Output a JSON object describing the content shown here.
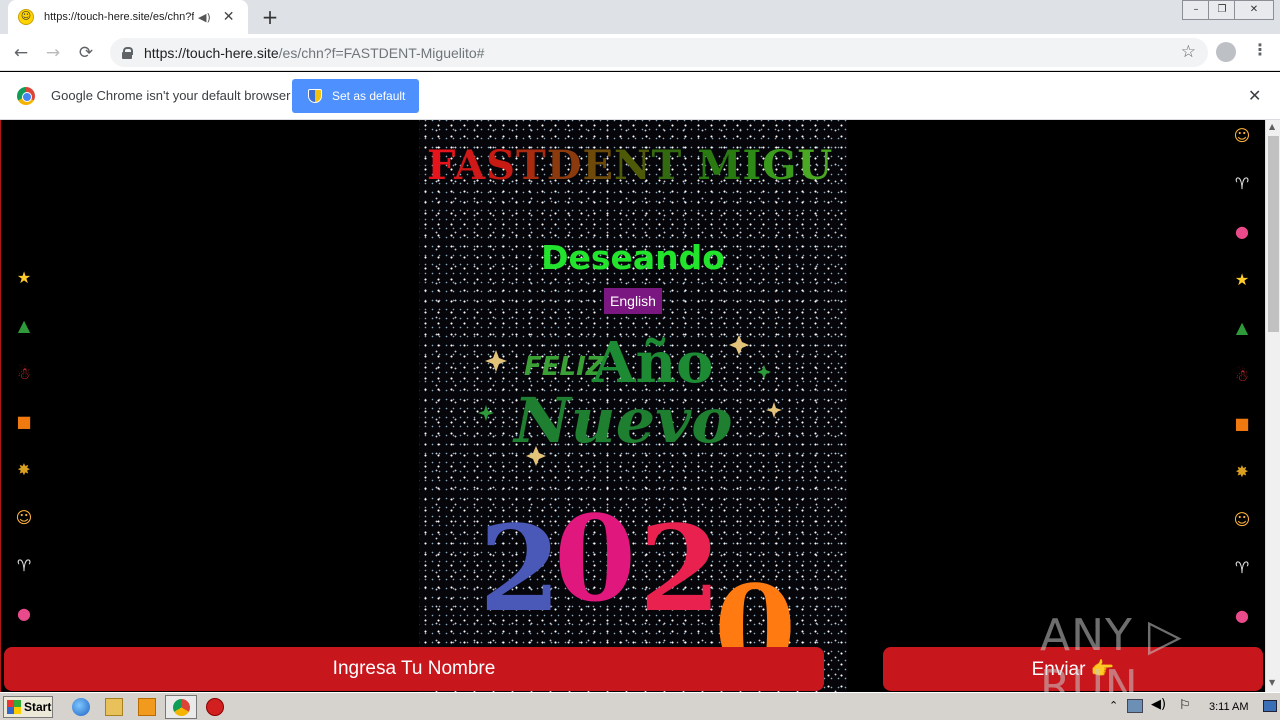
{
  "browser": {
    "tab": {
      "title": "https://touch-here.site/es/chn?f=FASTDENT-Miguelito#",
      "favicon": "smiley-icon"
    },
    "new_tab": "+",
    "window_buttons": {
      "minimize": "–",
      "restore": "❐",
      "close": "✕"
    },
    "url": {
      "host": "https://touch-here.site",
      "path": "/es/chn?f=FASTDENT-Miguelito#"
    },
    "nav": {
      "back": "←",
      "forward": "→",
      "reload": "⟳",
      "bookmark": "☆",
      "menu": "⋮"
    }
  },
  "infobar": {
    "message": "Google Chrome isn't your default browser",
    "button": "Set as default",
    "close": "✕"
  },
  "page": {
    "brand": "FASTDENT MIGU",
    "brand_colors": [
      "#e8141b",
      "#d01818",
      "#c61a12",
      "#a82b10",
      "#8a3a0c",
      "#6e4a0a",
      "#4f5a08",
      "#336a10",
      "#2a7a12",
      "#2d8a16",
      "#3a9a1c",
      "#4aa822",
      "#5ab828"
    ],
    "greeting": "Deseando",
    "language_button": "English",
    "feliz_line1": "FELIZ",
    "feliz_line2": "Año",
    "feliz_line3": "Nuevo",
    "year_digits": [
      "2",
      "0",
      "2",
      "0"
    ],
    "year_colors": [
      "#4a58b8",
      "#e0187e",
      "#e8214f",
      "#ff7a10"
    ],
    "name_input_placeholder": "Ingresa Tu Nombre",
    "send_button": "Enviar 👉",
    "left_icons": [
      "star-icon",
      "tree-icon",
      "santa-icon",
      "gift-icon",
      "sparkler-icon",
      "face-icon",
      "cheers-icon",
      "balloons-icon",
      "star-icon"
    ],
    "right_icons": [
      "face-icon",
      "cheers-icon",
      "balloons-icon",
      "star-icon",
      "tree-icon",
      "santa-icon",
      "gift-icon",
      "sparkler-icon",
      "face-icon",
      "cheers-icon",
      "balloons-icon"
    ]
  },
  "watermark": "ANY ▷ RUN",
  "taskbar": {
    "start": "Start",
    "clock": "3:11 AM"
  }
}
